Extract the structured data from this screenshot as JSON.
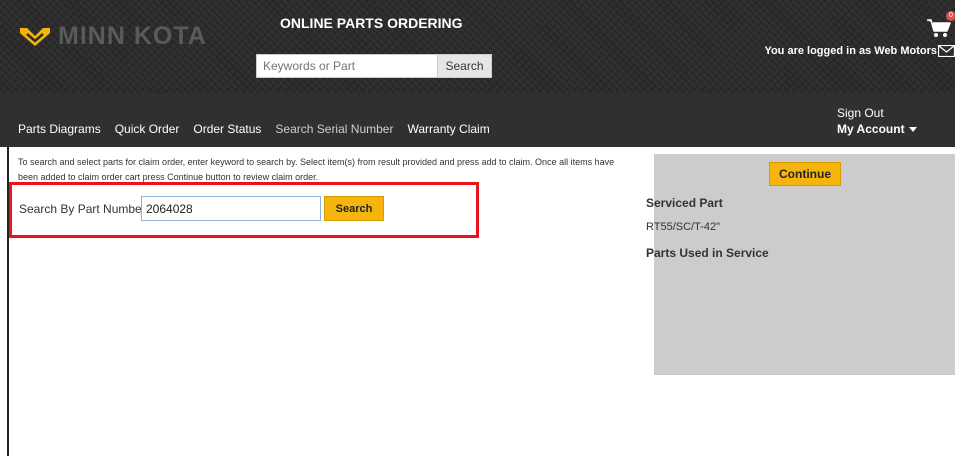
{
  "header": {
    "logo_text": "MINN KOTA",
    "site_title": "ONLINE PARTS ORDERING",
    "search_placeholder": "Keywords or Part",
    "search_button": "Search",
    "logged_in_text": "You are logged in as Web Motors"
  },
  "nav": {
    "links": [
      "Parts Diagrams",
      "Quick Order",
      "Order Status",
      "Search Serial Number",
      "Warranty Claim"
    ],
    "sign_out": "Sign Out",
    "my_account": "My Account",
    "cart_count": "0"
  },
  "main": {
    "instructions": "To search and select parts for claim order, enter keyword to search by. Select item(s) from result provided and press add to claim. Once all items have been added to claim order cart press Continue button to review claim order.",
    "part_label": "Search By Part Number",
    "part_value": "2064028",
    "search_button": "Search"
  },
  "side": {
    "continue_button": "Continue",
    "serviced_heading": "Serviced Part",
    "serviced_value": "RT55/SC/T-42\"",
    "used_heading": "Parts Used in Service"
  },
  "colors": {
    "accent": "#f5b50c",
    "highlight": "#e8141c",
    "header_bg": "#2b2b2b",
    "nav_bg": "#303030",
    "panel_bg": "#cccccc"
  },
  "icons": [
    "minn-kota-logo-icon",
    "mail-icon",
    "cart-icon",
    "caret-down-icon"
  ]
}
